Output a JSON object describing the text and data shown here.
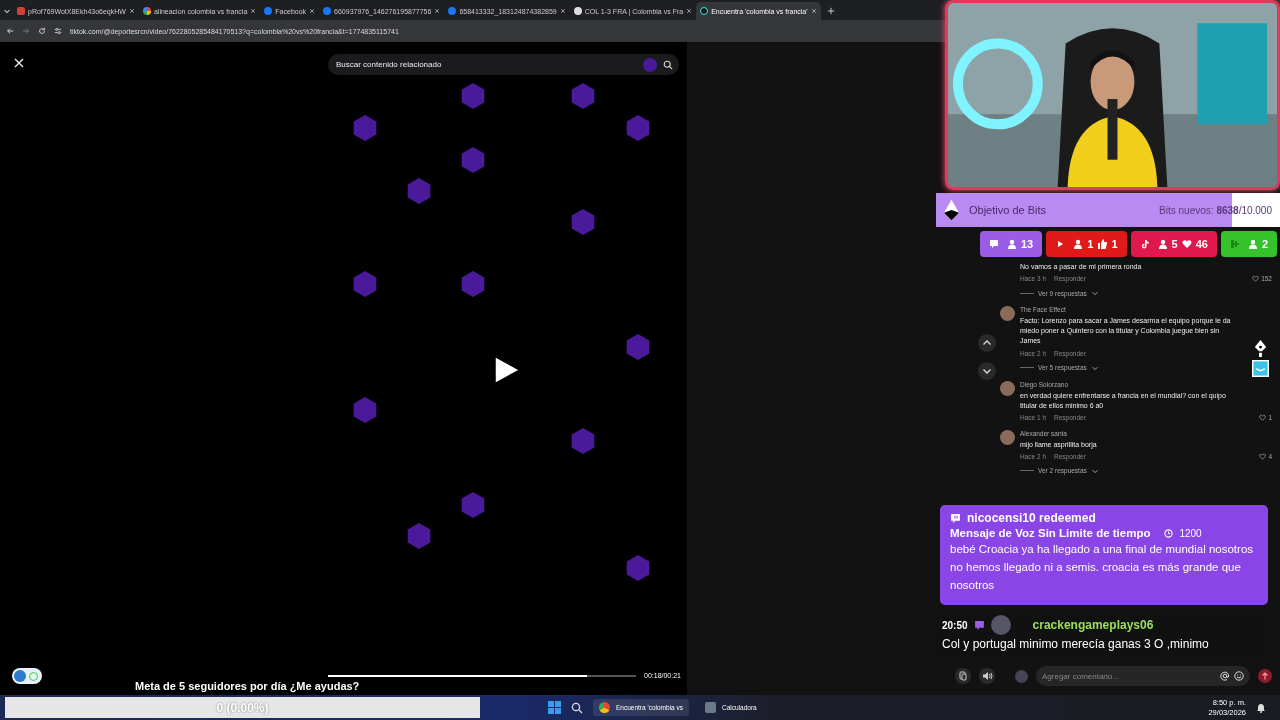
{
  "browser": {
    "tabs": [
      {
        "label": "pRof769WotX8Ekh43o6eqkHW",
        "kind": "puzzle",
        "selected": false
      },
      {
        "label": "alineacion colombia vs francia",
        "kind": "google",
        "selected": false
      },
      {
        "label": "Facebook",
        "kind": "facebook",
        "selected": false
      },
      {
        "label": "660937976_146276195877756",
        "kind": "facebook",
        "selected": false
      },
      {
        "label": "658413332_183124874382859",
        "kind": "facebook",
        "selected": false
      },
      {
        "label": "COL 1-3 FRA | Colombia vs Fra",
        "kind": "globe",
        "selected": false
      },
      {
        "label": "Encuentra 'colombia vs francia'",
        "kind": "tiktok",
        "selected": true
      }
    ],
    "url": "tiktok.com/@deportesrcn/video/7622805285484170513?q=colombia%20vs%20francia&t=1774835115741"
  },
  "video": {
    "search": {
      "placeholder": "Buscar contenido relacionado"
    },
    "progress": {
      "level": 0.84
    },
    "time": "00:18/00:21"
  },
  "comments": [
    {
      "text": "No vamos a pasar de mi primera ronda",
      "time": "Hace 3 h",
      "reply": "Responder",
      "likes": "152",
      "replies": "Ver 9 respuestas"
    },
    {
      "author": "The Face Effect",
      "text": "Facto: Lorenzo para sacar a James desarma el equipo porque le da miedo poner a Quintero con la titular y Colombia juegue bien sin James",
      "time": "Hace 2 h",
      "reply": "Responder",
      "replies": "Ver 5 respuestas"
    },
    {
      "author": "Diego Solorzano",
      "text": "en verdad quiere enfrentarse a francia en el mundial? con el quipo titular de ellos minimo 6 a0",
      "time": "Hace 1 h",
      "reply": "Responder",
      "likes": "1"
    },
    {
      "author": "Alexander santa",
      "text": "mijo llame asprillita borja",
      "time": "Hace 2 h",
      "reply": "Responder",
      "likes": "4",
      "replies": "Ver 2 respuestas"
    }
  ],
  "comment_box": {
    "placeholder": "Agregar comentario..."
  },
  "overlay": {
    "bits_goal": {
      "title": "Objetivo de Bits",
      "progress": "Bits nuevos: **8638**/10.000",
      "level": 0.86
    },
    "counters": [
      {
        "kind": "twitch",
        "color": "#9b5de5",
        "stats": [
          {
            "kind": "viewers",
            "value": "13"
          }
        ]
      },
      {
        "kind": "youtube",
        "color": "#e01919",
        "stats": [
          {
            "kind": "viewers",
            "value": "1"
          },
          {
            "kind": "likes",
            "value": "1"
          }
        ]
      },
      {
        "kind": "tiktok",
        "color": "#e0194d",
        "stats": [
          {
            "kind": "viewers",
            "value": "5"
          },
          {
            "kind": "hearts",
            "value": "46"
          }
        ]
      },
      {
        "kind": "kick",
        "color": "#35c22a",
        "stats": [
          {
            "kind": "viewers",
            "value": "2"
          }
        ]
      }
    ],
    "alert": {
      "user": "nicocensi10 redeemed",
      "reward": "Mensaje de Voz Sin Limite de tiempo",
      "cost": "1200",
      "message": "bebé Croacia ya ha llegado a una final de mundial nosotros no hemos llegado ni a semis. croacia es más grande que nosotros"
    },
    "chat": {
      "time": "20:50",
      "user": "crackengameplays06",
      "message": "Col y portugal minimo merecía ganas 3 O ,minimo"
    },
    "follower_goal": {
      "title": "Meta de 5 seguidores por día ¿Me ayudas?",
      "progress": "0 (0.00%)",
      "level": 0
    }
  },
  "taskbar": {
    "apps": [
      {
        "label": "Encuentra 'colombia vs",
        "kind": "chrome",
        "selected": true
      },
      {
        "label": "Calculadora",
        "kind": "calculator",
        "selected": false
      }
    ],
    "time": "8:50 p. m.",
    "date": "29/03/2026"
  }
}
